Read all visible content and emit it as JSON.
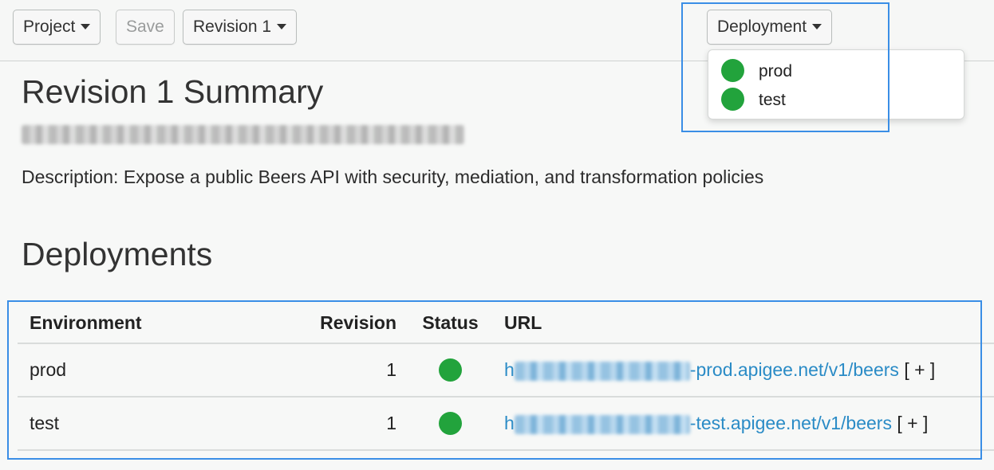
{
  "toolbar": {
    "project_label": "Project",
    "save_label": "Save",
    "revision_label": "Revision 1",
    "deployment_label": "Deployment"
  },
  "deployment_menu": {
    "items": [
      {
        "label": "prod",
        "status": "deployed",
        "color": "#22a33c"
      },
      {
        "label": "test",
        "status": "deployed",
        "color": "#22a33c"
      }
    ]
  },
  "summary": {
    "title": "Revision 1 Summary",
    "description": "Description: Expose a public Beers API with security, mediation, and transformation policies"
  },
  "deployments": {
    "heading": "Deployments",
    "columns": [
      "Environment",
      "Revision",
      "Status",
      "URL"
    ],
    "rows": [
      {
        "environment": "prod",
        "revision": "1",
        "status": "deployed",
        "url_suffix": "-prod.apigee.net/v1/beers",
        "url_prefix_visible": "h",
        "action": "[ + ]"
      },
      {
        "environment": "test",
        "revision": "1",
        "status": "deployed",
        "url_suffix": "-test.apigee.net/v1/beers",
        "url_prefix_visible": "h",
        "action": "[ + ]"
      }
    ]
  },
  "colors": {
    "status_green": "#22a33c",
    "link_blue": "#2a8bc6",
    "highlight_blue": "#3a8ee6"
  }
}
